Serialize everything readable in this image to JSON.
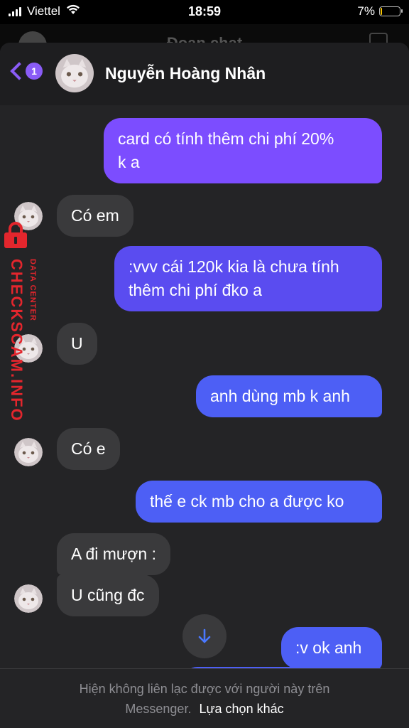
{
  "status_bar": {
    "carrier": "Viettel",
    "time": "18:59",
    "battery_percent": "7%",
    "battery_level": 0.07
  },
  "background": {
    "title": "Đoạn chat"
  },
  "header": {
    "back_badge": "1",
    "contact_name": "Nguyễn Hoàng Nhân"
  },
  "messages": [
    {
      "from": "me",
      "text_lines": [
        "card có tính thêm chi phí 20%",
        "k a"
      ]
    },
    {
      "from": "them",
      "text": "Có em"
    },
    {
      "from": "me",
      "text_lines": [
        ":vvv cái 120k kia là chưa tính",
        "thêm chi phí đko a"
      ]
    },
    {
      "from": "them",
      "text": "U"
    },
    {
      "from": "me",
      "text": "anh dùng mb k anh"
    },
    {
      "from": "them",
      "text": "Có e"
    },
    {
      "from": "me",
      "text": "thế e ck mb cho a được ko"
    },
    {
      "from": "them",
      "text": "A đi mượn :"
    },
    {
      "from": "them",
      "text": "U cũng đc"
    },
    {
      "from": "me",
      "text": ":v ok anh"
    }
  ],
  "footer": {
    "line1": "Hiện không liên lạc được với người này trên",
    "line2_muted": "Messenger.",
    "line2_link": "Lựa chọn khác"
  },
  "watermark": {
    "main": "CHECKSCAM.INFO",
    "sub": "DATA CENTER"
  },
  "icons": {
    "wifi": "wifi-icon",
    "scroll_down": "arrow-down-icon",
    "back": "chevron-left-icon",
    "lock": "lock-icon"
  },
  "colors": {
    "accent": "#8a5cf6",
    "outgoing_top": "#7c4dff",
    "outgoing_bottom": "#4d5ff5",
    "incoming": "#3a3a3c",
    "watermark": "#e3262d"
  }
}
